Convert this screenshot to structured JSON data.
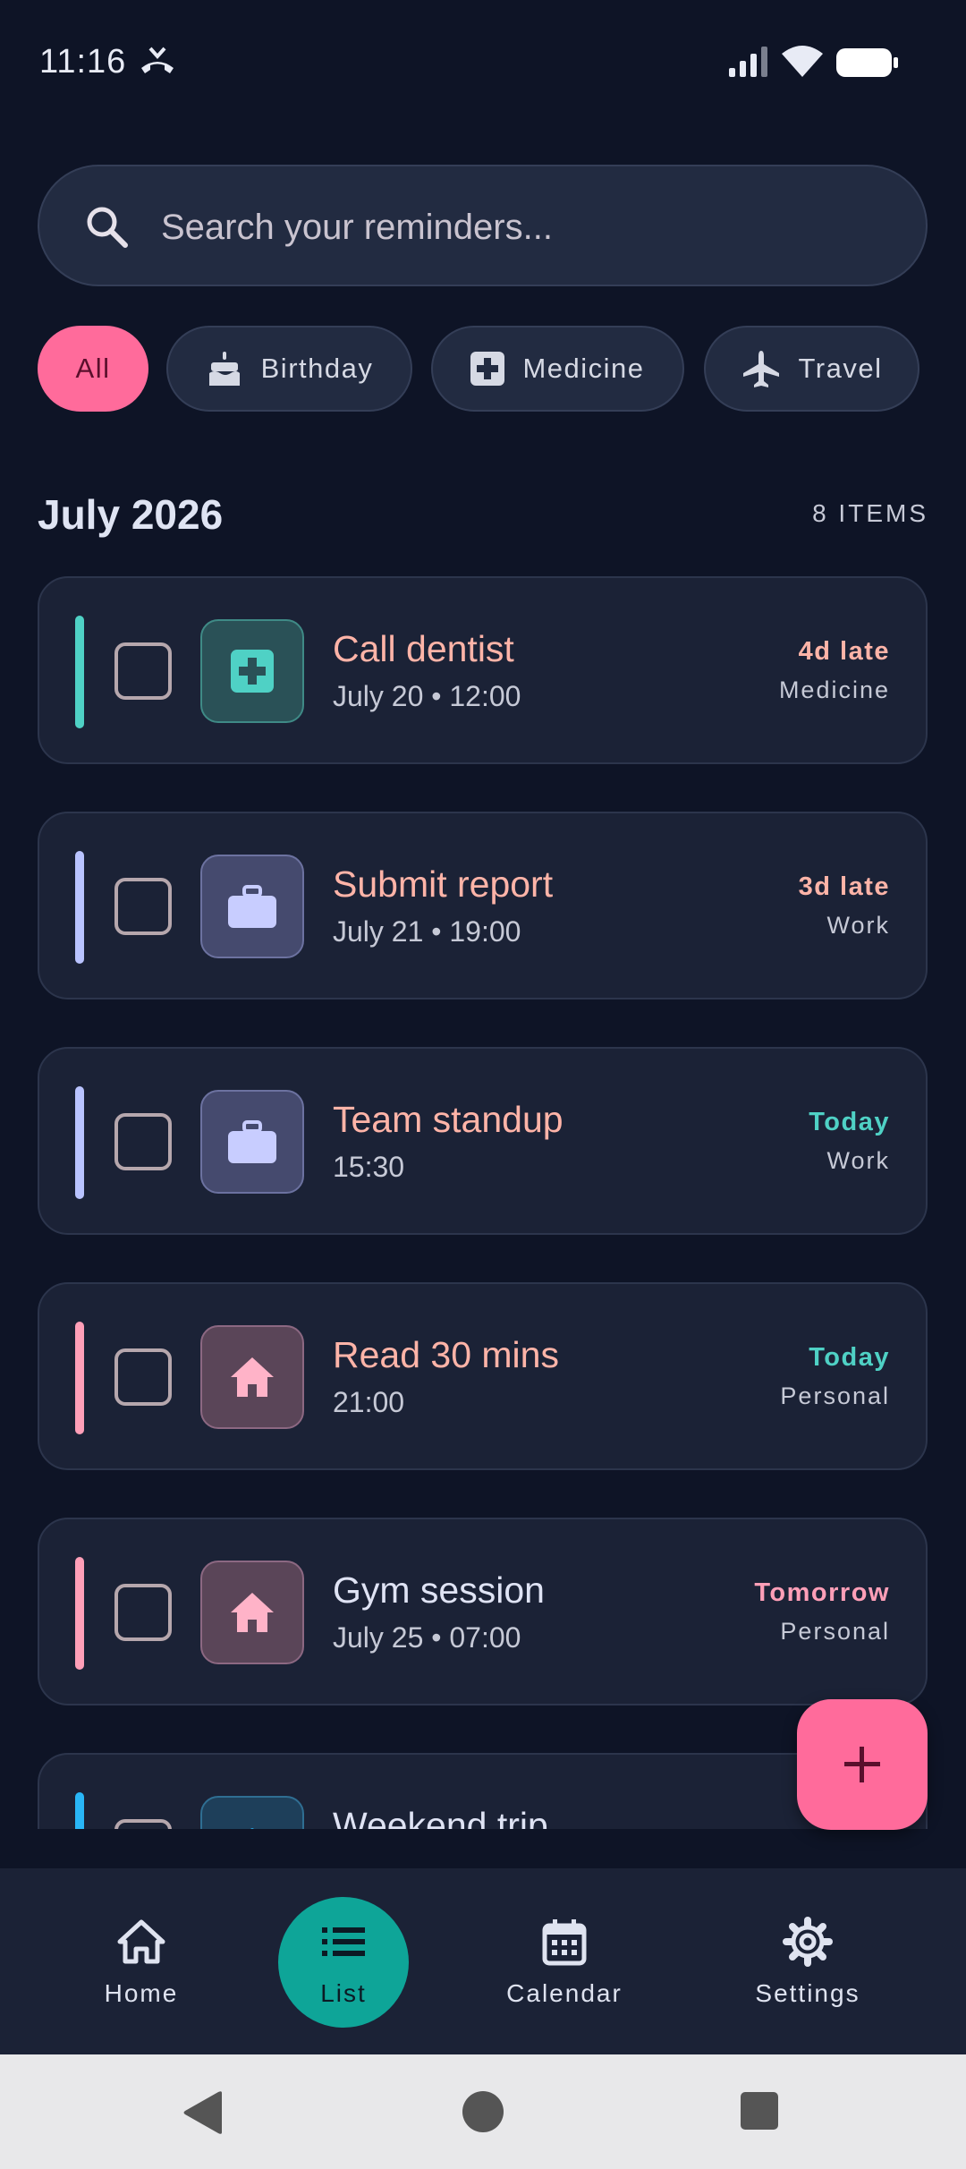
{
  "status_bar": {
    "time": "11:16"
  },
  "search": {
    "placeholder": "Search your reminders..."
  },
  "filters": [
    {
      "label": "All",
      "icon": "none",
      "active": true
    },
    {
      "label": "Birthday",
      "icon": "cake-icon",
      "active": false
    },
    {
      "label": "Medicine",
      "icon": "medical-cross-icon",
      "active": false
    },
    {
      "label": "Travel",
      "icon": "airplane-icon",
      "active": false
    }
  ],
  "section": {
    "title": "July 2026",
    "count": "8 ITEMS"
  },
  "reminders": [
    {
      "title": "Call dentist",
      "subtitle": "July 20 • 12:00",
      "status": "4d late",
      "category": "Medicine",
      "icon": "medical-cross-icon",
      "accent": "#4fd1c5",
      "status_color": "#ffb4a8"
    },
    {
      "title": "Submit report",
      "subtitle": "July 21 • 19:00",
      "status": "3d late",
      "category": "Work",
      "icon": "briefcase-icon",
      "accent": "#b9c3ff",
      "status_color": "#ffb4a8"
    },
    {
      "title": "Team standup",
      "subtitle": "15:30",
      "status": "Today",
      "category": "Work",
      "icon": "briefcase-icon",
      "accent": "#b9c3ff",
      "status_color": "#4fd1c5"
    },
    {
      "title": "Read 30 mins",
      "subtitle": "21:00",
      "status": "Today",
      "category": "Personal",
      "icon": "home-icon",
      "accent": "#ff9fb8",
      "status_color": "#4fd1c5"
    },
    {
      "title": "Gym session",
      "subtitle": "July 25 • 07:00",
      "status": "Tomorrow",
      "category": "Personal",
      "icon": "home-icon",
      "accent": "#ff9fb8",
      "status_color": "#ff9fb8"
    },
    {
      "title": "Weekend trip",
      "subtitle": "",
      "status": "",
      "category": "",
      "icon": "airplane-icon",
      "accent": "#29b6f6",
      "status_color": "#29b6f6"
    }
  ],
  "fab": {
    "icon": "plus-icon"
  },
  "bottom_nav": [
    {
      "label": "Home",
      "icon": "home-outline-icon",
      "active": false
    },
    {
      "label": "List",
      "icon": "list-icon",
      "active": true
    },
    {
      "label": "Calendar",
      "icon": "calendar-icon",
      "active": false
    },
    {
      "label": "Settings",
      "icon": "gear-icon",
      "active": false
    }
  ],
  "colors": {
    "background": "#0e1426",
    "surface": "#1b2236",
    "accent_pink": "#ff6b9b",
    "accent_teal": "#0ea598"
  }
}
